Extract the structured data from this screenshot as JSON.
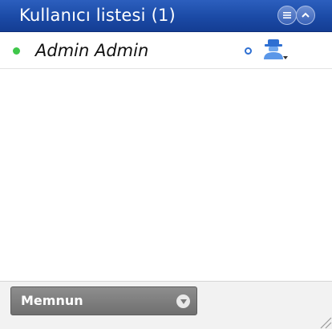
{
  "header": {
    "title": "Kullanıcı listesi (1)",
    "menu_icon": "list-menu-icon",
    "collapse_icon": "chevron-up-icon"
  },
  "users": [
    {
      "name": "Admin Admin",
      "status_color": "#3fc74a",
      "icons": [
        "ring-icon",
        "user-moderator-icon"
      ]
    }
  ],
  "footer": {
    "status_select": {
      "selected": "Memnun",
      "icon": "chevron-down-icon"
    }
  },
  "colors": {
    "header_bg": "#1b4aa6",
    "accent_blue": "#2e6fd2",
    "online_green": "#3fc74a",
    "select_bg": "#7a7a7a"
  }
}
